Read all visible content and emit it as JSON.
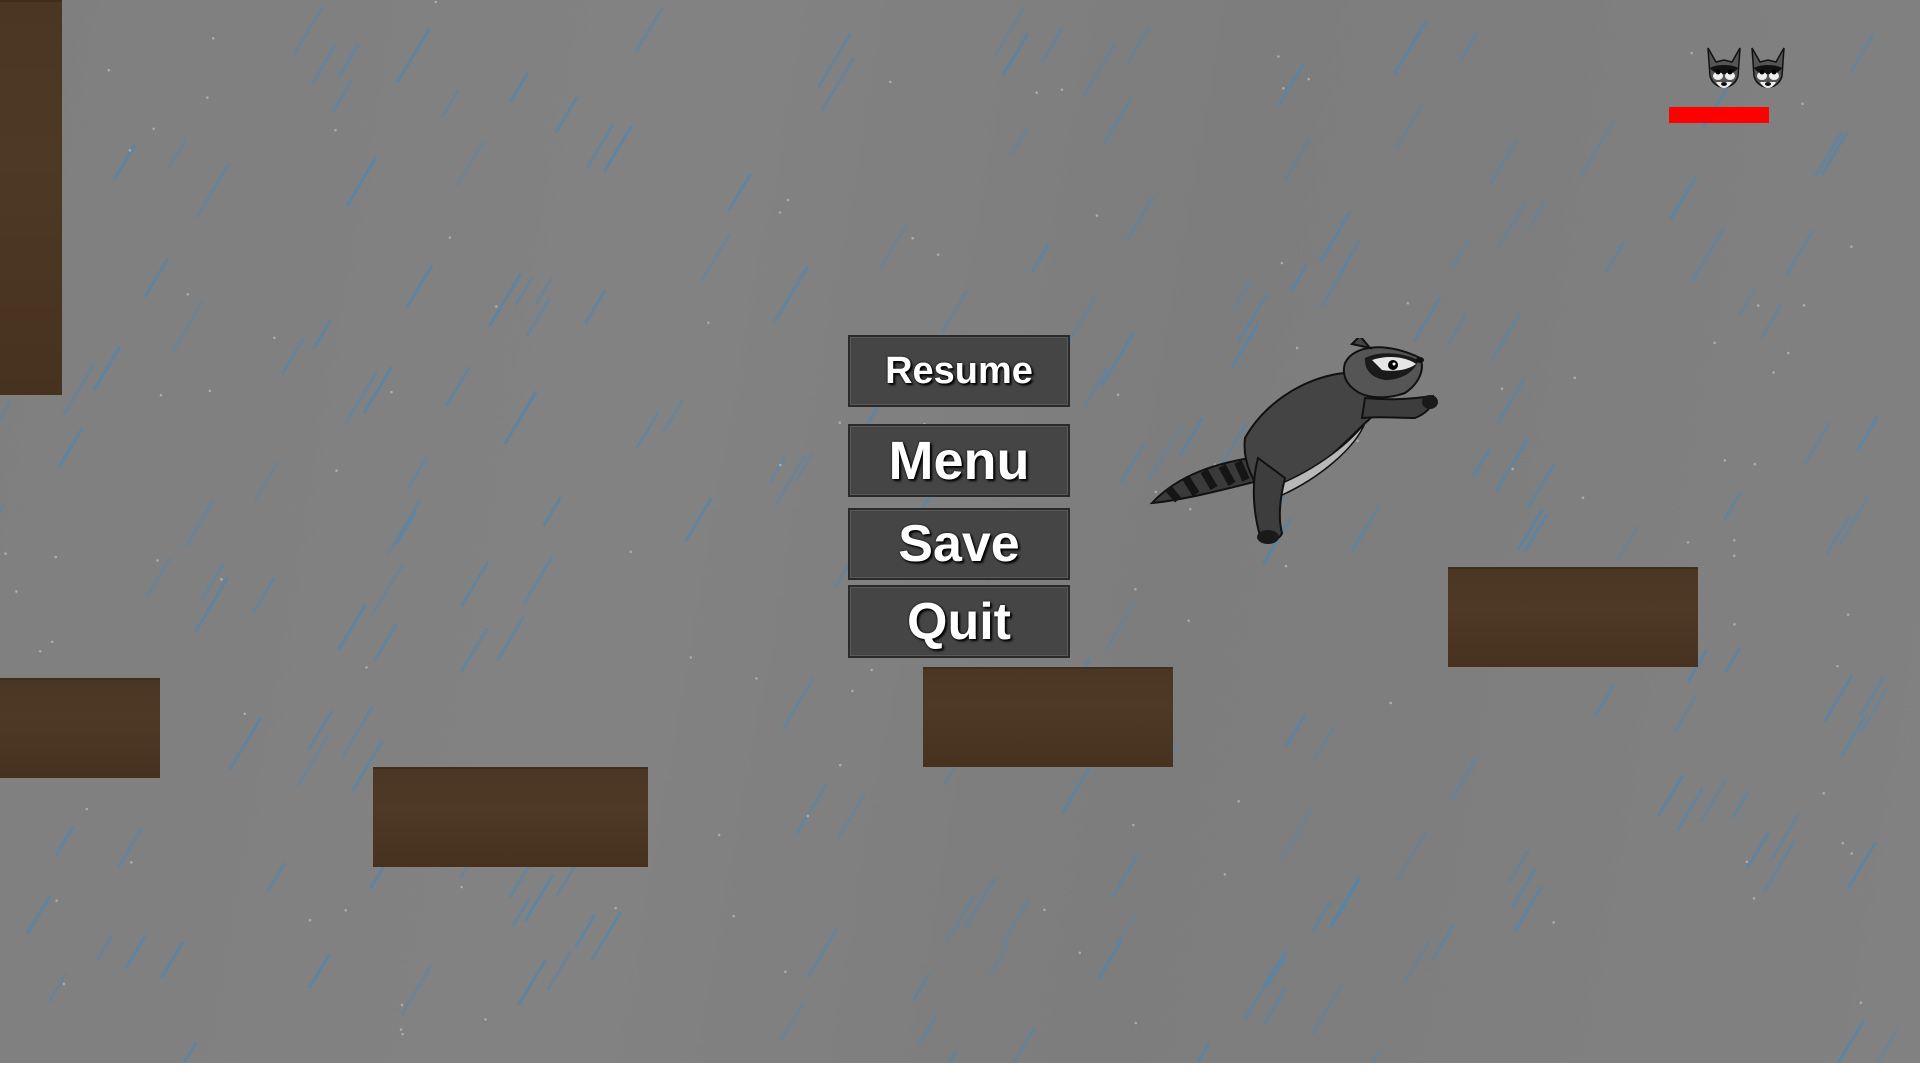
{
  "pause_menu": {
    "resume_label": "Resume",
    "menu_label": "Menu",
    "save_label": "Save",
    "quit_label": "Quit"
  },
  "hud": {
    "lives": 2,
    "health_fraction": 1.0,
    "health_color": "#ff0000"
  },
  "colors": {
    "background": "#808080",
    "platform": "#4b3623",
    "button": "#454545",
    "rain": "#4f86b0"
  },
  "player_icon": "raccoon-icon",
  "life_icon": "raccoon-head-icon"
}
